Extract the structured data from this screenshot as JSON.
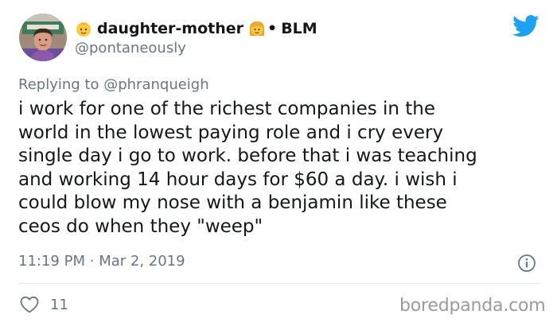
{
  "tweet": {
    "display_name": "daughter-mother",
    "name_suffix": "BLM",
    "bullet": "•",
    "handle": "@pontaneously",
    "reply_prefix": "Replying to",
    "reply_to": "@phranqueigh",
    "text": "i work for one of the richest companies in the\nworld in the lowest paying role and i cry every\nsingle day i go to work. before that  i was teaching\nand working 14 hour days for $60 a day. i wish i\ncould blow my nose with a benjamin like these\nceos do when they \"weep\"",
    "time": "11:19 PM",
    "separator": "·",
    "date": "Mar 2, 2019",
    "like_count": "11"
  },
  "icons": {
    "brand": "twitter-bird-icon",
    "info": "info-icon",
    "like": "heart-icon",
    "emoji_1": "baby-emoji-icon",
    "emoji_2": "woman-emoji-icon"
  },
  "colors": {
    "twitter_blue": "#1da1f2",
    "secondary_text": "#657786",
    "primary_text": "#14171a",
    "divider": "#e1e8ed",
    "emoji_yellow": "#ffc83d"
  },
  "watermark": "boredpanda.com"
}
